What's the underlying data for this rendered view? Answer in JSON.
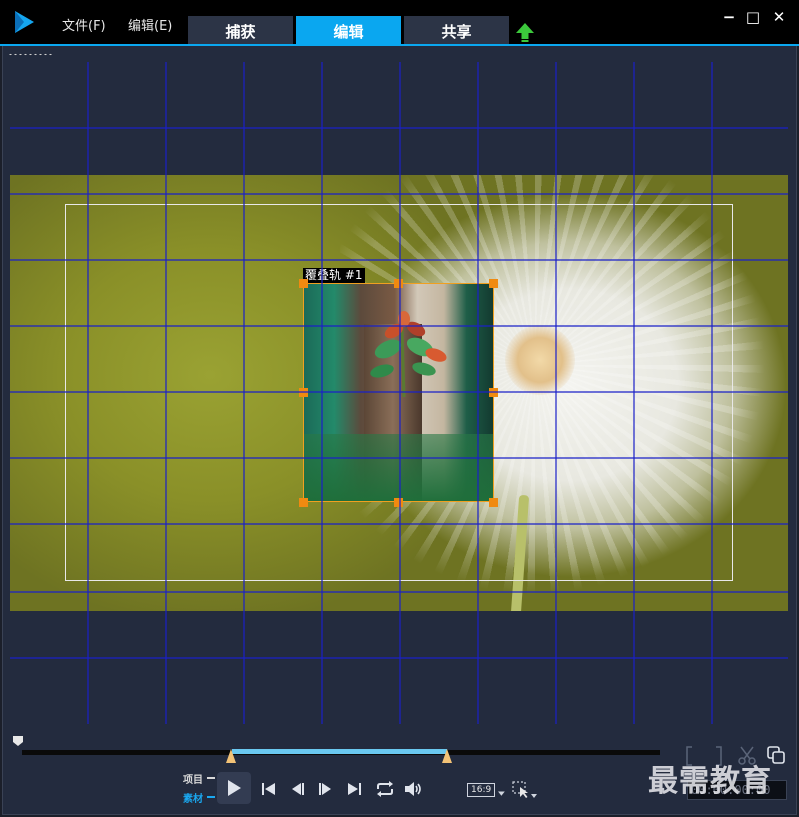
{
  "menu": {
    "file": "文件(F)",
    "edit": "编辑(E)"
  },
  "tabs": [
    {
      "label": "捕获"
    },
    {
      "label": "编辑",
      "active": true
    },
    {
      "label": "共享"
    }
  ],
  "window": {
    "minimize": "−",
    "maximize": "□",
    "close": "✕"
  },
  "preview": {
    "overlay_track_label": "覆叠轨 #1"
  },
  "transport": {
    "mode_project": "项目",
    "mode_clip": "素材",
    "aspect_ratio": "16:9",
    "timecode": "00:00:00:00"
  },
  "watermark": "最需教育",
  "colors": {
    "accent": "#0aa7f0",
    "handle": "#f08a10",
    "grid": "#1a20c8",
    "selection": "#6ac8f0",
    "upload_green": "#3cc83c"
  },
  "icons": [
    "app-logo-icon",
    "upload-icon",
    "play-icon",
    "skip-start-icon",
    "step-back-icon",
    "step-forward-icon",
    "skip-end-icon",
    "repeat-icon",
    "volume-icon",
    "crop-select-icon",
    "scissors-icon",
    "copy-icon"
  ]
}
